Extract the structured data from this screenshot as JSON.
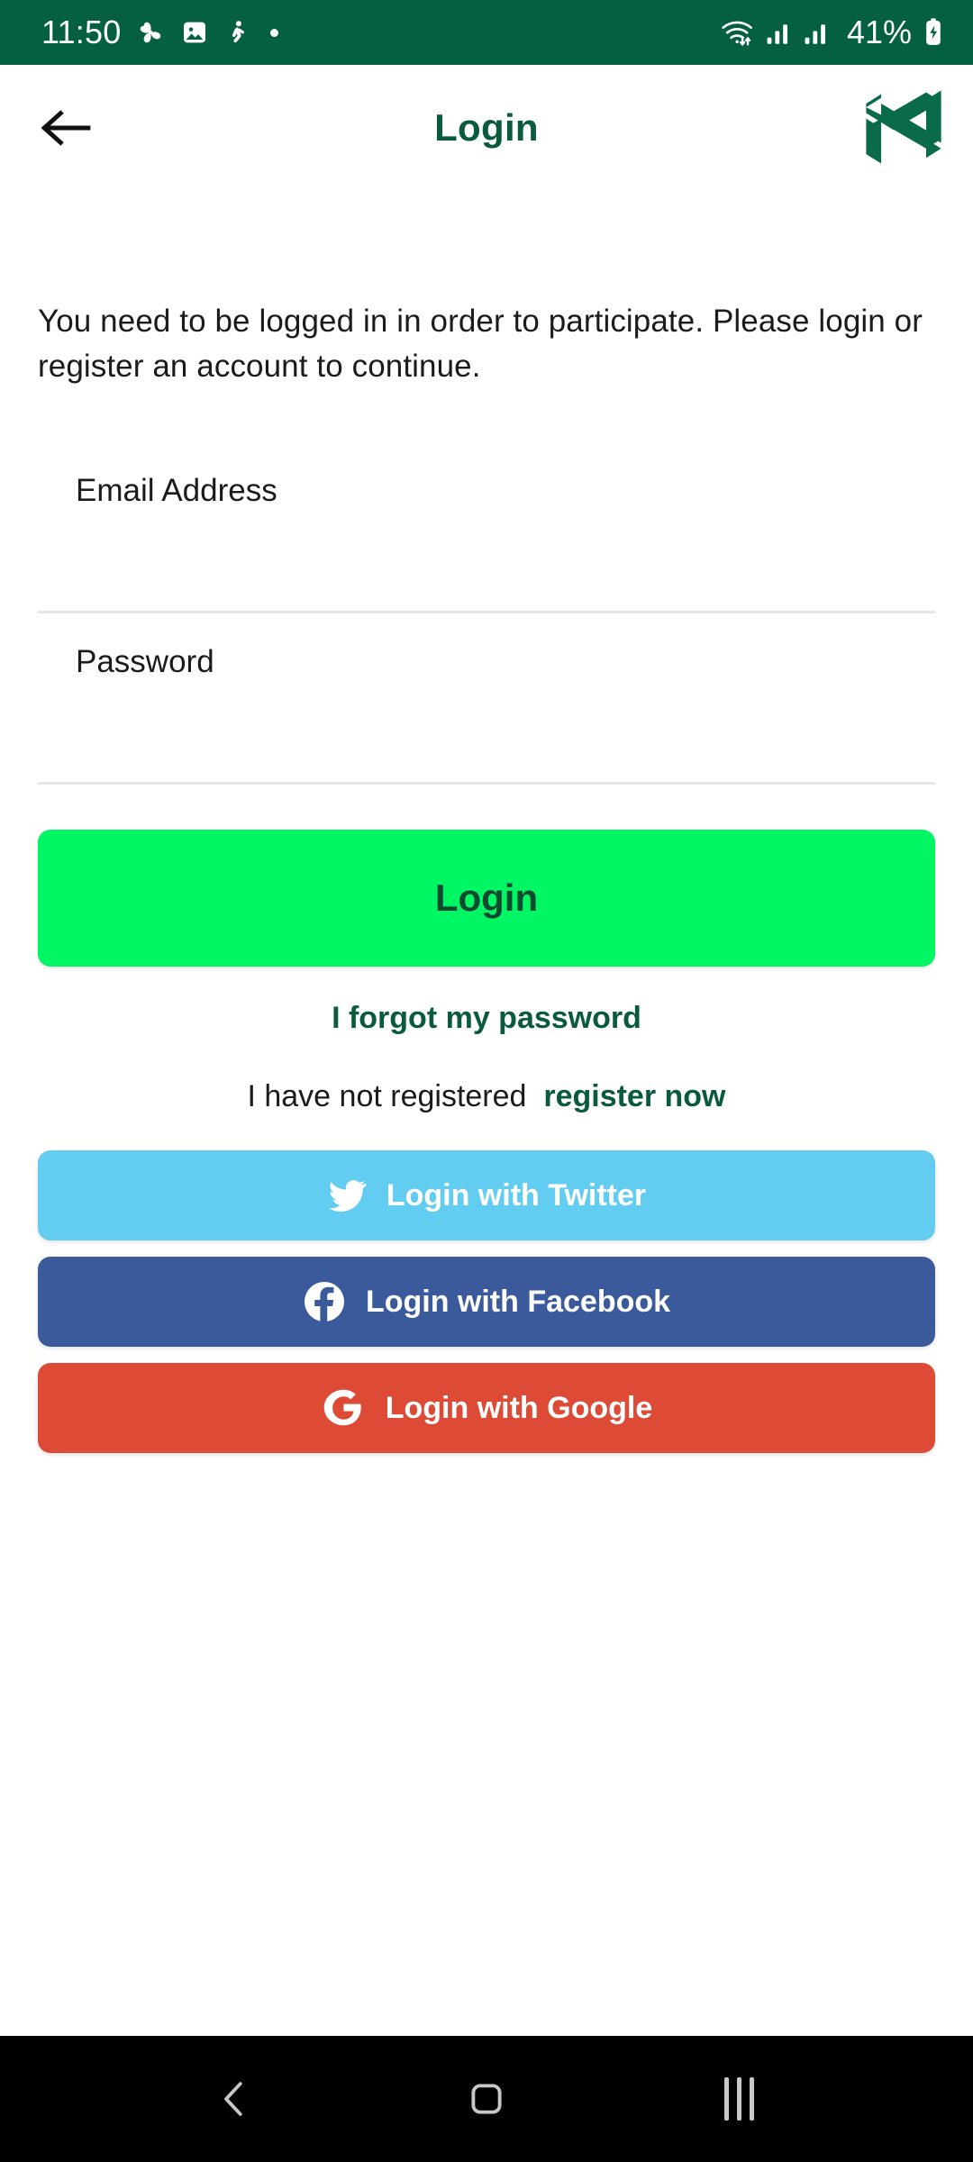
{
  "status_bar": {
    "time": "11:50",
    "battery_percent": "41%",
    "background_color": "#056042",
    "left_icons": [
      "pinwheel-icon",
      "gallery-image-icon",
      "person-activity-icon",
      "dot-icon"
    ],
    "right_icons": [
      "wifi-icon",
      "signal-sim1-icon",
      "signal-sim2-icon",
      "battery-charging-icon"
    ]
  },
  "header": {
    "back_label": "back-arrow",
    "title": "Login",
    "logo_name": "nedbank-n-logo",
    "title_color": "#0a5a3c"
  },
  "main": {
    "intro_text": "You need to be logged in in order to participate. Please login or register an account to continue.",
    "form": {
      "email": {
        "label": "Email Address",
        "placeholder": "Email Address",
        "value": ""
      },
      "password": {
        "label": "Password",
        "placeholder": "Password",
        "value": ""
      }
    },
    "login_button": {
      "label": "Login",
      "background_color": "#00f763",
      "text_color": "#0b4a30"
    },
    "forgot_password_link": "I forgot my password",
    "register_prompt": "I have not registered",
    "register_link": "register now",
    "social_buttons": [
      {
        "label": "Login with Twitter",
        "icon": "twitter-bird-icon",
        "background_color": "#62cdf0"
      },
      {
        "label": "Login with Facebook",
        "icon": "facebook-f-icon",
        "background_color": "#3a5a9b"
      },
      {
        "label": "Login with Google",
        "icon": "google-g-icon",
        "background_color": "#dd4b36"
      }
    ]
  },
  "nav_bar": {
    "background_color": "#000000",
    "items": [
      {
        "name": "back-chevron-icon"
      },
      {
        "name": "home-square-icon"
      },
      {
        "name": "recents-icon"
      }
    ]
  }
}
